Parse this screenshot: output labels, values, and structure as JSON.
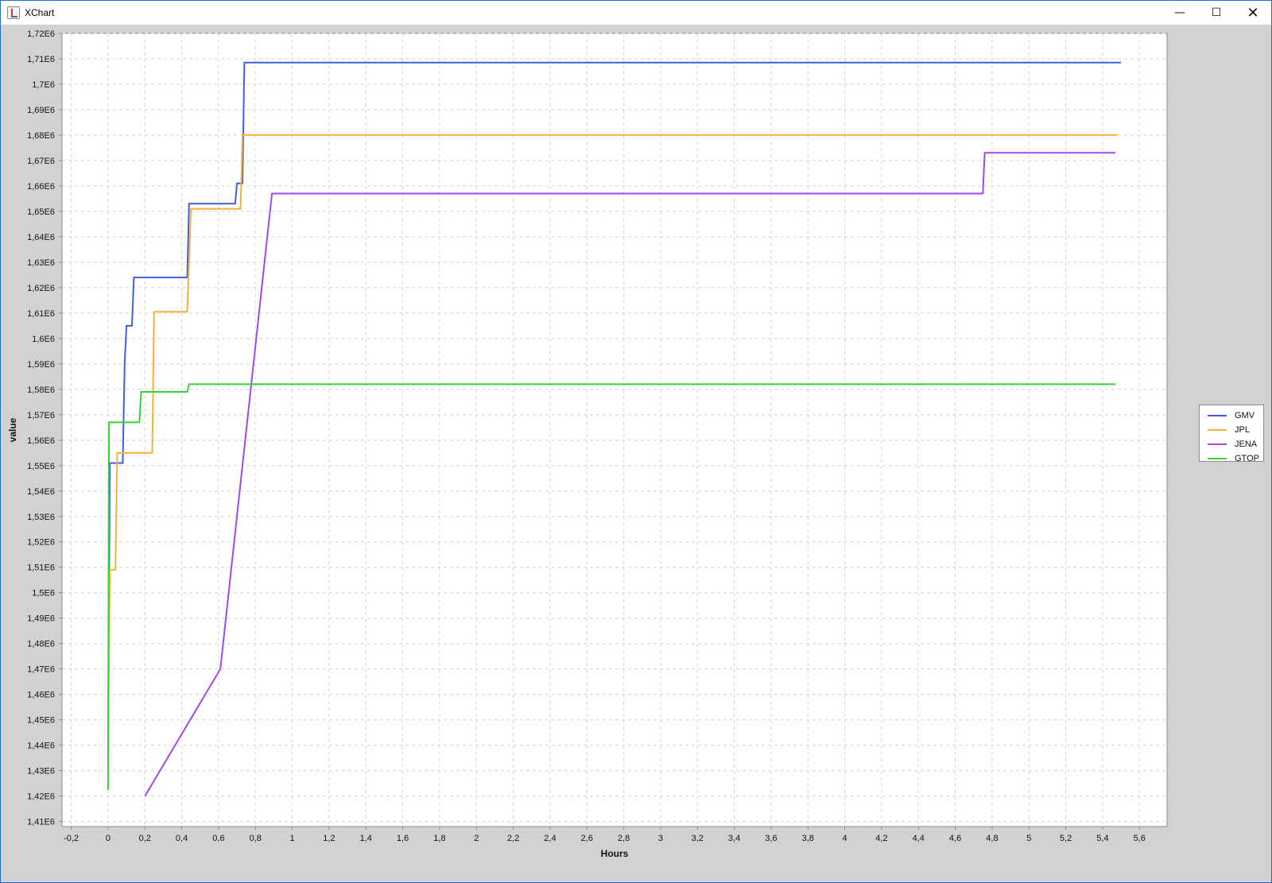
{
  "window": {
    "title": "XChart"
  },
  "controls": {
    "minimize": "—",
    "maximize": "☐",
    "close": "✕"
  },
  "chart_data": {
    "type": "line",
    "xlabel": "Hours",
    "ylabel": "value",
    "xlim": [
      -0.25,
      5.75
    ],
    "ylim": [
      1408000,
      1720000
    ],
    "grid": true,
    "legend_position": "right",
    "x_ticks": [
      "-0,2",
      "0",
      "0,2",
      "0,4",
      "0,6",
      "0,8",
      "1",
      "1,2",
      "1,4",
      "1,6",
      "1,8",
      "2",
      "2,2",
      "2,4",
      "2,6",
      "2,8",
      "3",
      "3,2",
      "3,4",
      "3,6",
      "3,8",
      "4",
      "4,2",
      "4,4",
      "4,6",
      "4,8",
      "5",
      "5,2",
      "5,4",
      "5,6"
    ],
    "x_tick_values": [
      -0.2,
      0,
      0.2,
      0.4,
      0.6,
      0.8,
      1,
      1.2,
      1.4,
      1.6,
      1.8,
      2,
      2.2,
      2.4,
      2.6,
      2.8,
      3,
      3.2,
      3.4,
      3.6,
      3.8,
      4,
      4.2,
      4.4,
      4.6,
      4.8,
      5,
      5.2,
      5.4,
      5.6
    ],
    "y_ticks": [
      "1,41E6",
      "1,42E6",
      "1,43E6",
      "1,44E6",
      "1,45E6",
      "1,46E6",
      "1,47E6",
      "1,48E6",
      "1,49E6",
      "1,5E6",
      "1,51E6",
      "1,52E6",
      "1,53E6",
      "1,54E6",
      "1,55E6",
      "1,56E6",
      "1,57E6",
      "1,58E6",
      "1,59E6",
      "1,6E6",
      "1,61E6",
      "1,62E6",
      "1,63E6",
      "1,64E6",
      "1,65E6",
      "1,66E6",
      "1,67E6",
      "1,68E6",
      "1,69E6",
      "1,7E6",
      "1,71E6",
      "1,72E6"
    ],
    "y_tick_values": [
      1410000,
      1420000,
      1430000,
      1440000,
      1450000,
      1460000,
      1470000,
      1480000,
      1490000,
      1500000,
      1510000,
      1520000,
      1530000,
      1540000,
      1550000,
      1560000,
      1570000,
      1580000,
      1590000,
      1600000,
      1610000,
      1620000,
      1630000,
      1640000,
      1650000,
      1660000,
      1670000,
      1680000,
      1690000,
      1700000,
      1710000,
      1720000
    ],
    "series": [
      {
        "name": "GMV",
        "color": "#3f5fe0",
        "x": [
          0.0,
          0.01,
          0.01,
          0.08,
          0.09,
          0.1,
          0.13,
          0.14,
          0.43,
          0.44,
          0.69,
          0.7,
          0.73,
          0.74,
          5.5
        ],
        "y": [
          1435000,
          1551000,
          1551000,
          1551000,
          1590000,
          1605000,
          1605000,
          1624000,
          1624000,
          1653000,
          1653000,
          1661000,
          1661000,
          1708500,
          1708500
        ]
      },
      {
        "name": "JPL",
        "color": "#f7b13b",
        "x": [
          0.0,
          0.01,
          0.01,
          0.04,
          0.05,
          0.24,
          0.25,
          0.43,
          0.45,
          0.72,
          0.73,
          5.48
        ],
        "y": [
          1435000,
          1509000,
          1509000,
          1509000,
          1555000,
          1555000,
          1610500,
          1610500,
          1651000,
          1651000,
          1680000,
          1680000
        ]
      },
      {
        "name": "JENA",
        "color": "#a347ee",
        "x": [
          0.2,
          0.61,
          0.89,
          4.75,
          4.76,
          5.47
        ],
        "y": [
          1420000,
          1470000,
          1657000,
          1657000,
          1673000,
          1673000
        ]
      },
      {
        "name": "GTOP",
        "color": "#35d135",
        "x": [
          0.0,
          0.005,
          0.01,
          0.17,
          0.18,
          0.43,
          0.44,
          5.47
        ],
        "y": [
          1422500,
          1567000,
          1567000,
          1567000,
          1579000,
          1579000,
          1582000,
          1582000
        ]
      }
    ]
  }
}
